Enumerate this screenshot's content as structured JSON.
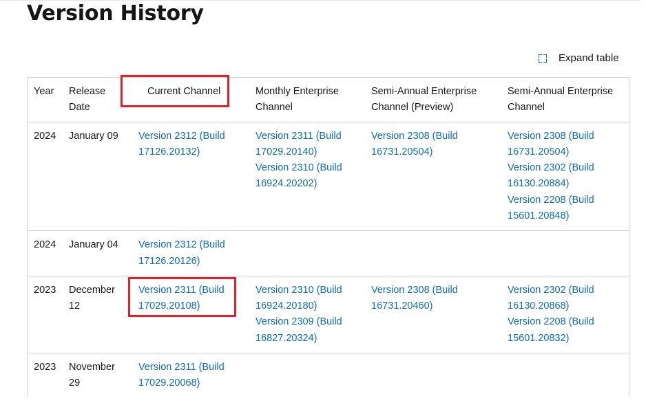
{
  "page": {
    "title": "Version History",
    "expand_table_label": "Expand table",
    "expand_icon": "expand-icon"
  },
  "colors": {
    "link": "#0f6cbd",
    "highlight": "#e3202a",
    "border": "#d1d1d1"
  },
  "table": {
    "headers": {
      "year": "Year",
      "release_date": "Release Date",
      "current": "Current Channel",
      "monthly": "Monthly Enterprise Channel",
      "sa_preview": "Semi-Annual Enterprise Channel (Preview)",
      "sa": "Semi-Annual Enterprise Channel"
    },
    "rows": [
      {
        "year": "2024",
        "date": "January 09",
        "current": [
          "Version 2312 (Build 17126.20132)"
        ],
        "monthly": [
          "Version 2311 (Build 17029.20140)",
          "Version 2310 (Build 16924.20202)"
        ],
        "sa_preview": [
          "Version 2308 (Build 16731.20504)"
        ],
        "sa": [
          "Version 2308 (Build 16731.20504)",
          "Version 2302 (Build 16130.20884)",
          "Version 2208 (Build 15601.20848)"
        ]
      },
      {
        "year": "2024",
        "date": "January 04",
        "current": [
          "Version 2312 (Build 17126.20126)"
        ],
        "monthly": [],
        "sa_preview": [],
        "sa": []
      },
      {
        "year": "2023",
        "date": "December 12",
        "current": [
          "Version 2311 (Build 17029.20108)"
        ],
        "monthly": [
          "Version 2310 (Build 16924.20180)",
          "Version 2309 (Build 16827.20324)"
        ],
        "sa_preview": [
          "Version 2308 (Build 16731.20460)"
        ],
        "sa": [
          "Version 2302 (Build 16130.20868)",
          "Version 2208 (Build 15601.20832)"
        ]
      },
      {
        "year": "2023",
        "date": "November 29",
        "current": [
          "Version 2311 (Build 17029.20068)"
        ],
        "monthly": [],
        "sa_preview": [],
        "sa": []
      }
    ]
  },
  "annotations": {
    "highlighted": [
      "Current Channel header",
      "Version 2311 (Build 17029.20108)"
    ]
  }
}
